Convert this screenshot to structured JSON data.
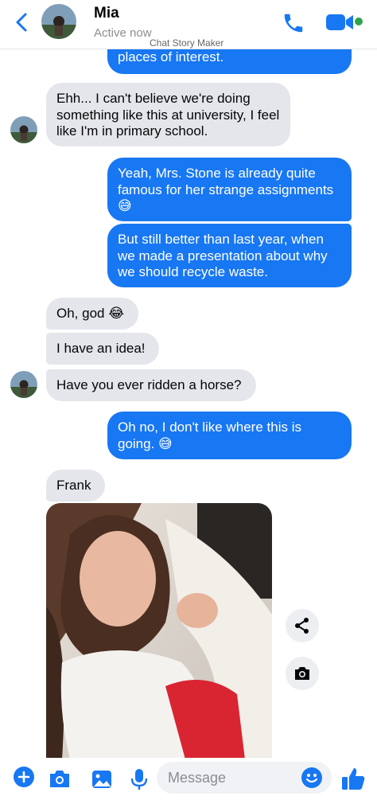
{
  "header": {
    "name": "Mia",
    "status": "Active now",
    "watermark": "Chat Story Maker"
  },
  "messages": [
    {
      "side": "out",
      "text": "places of interest."
    },
    {
      "side": "in",
      "text": "Ehh... I can't believe we're doing something like this at university, I feel like I'm in primary school."
    },
    {
      "side": "out",
      "text": "Yeah, Mrs. Stone is already quite famous for her strange assignments 😅"
    },
    {
      "side": "out",
      "text": "But still better than last year, when we made a presentation about why we should recycle waste."
    },
    {
      "side": "in",
      "text": "Oh, god 😂"
    },
    {
      "side": "in",
      "text": "I have an idea!"
    },
    {
      "side": "in",
      "text": "Have you ever ridden a horse?"
    },
    {
      "side": "out",
      "text": "Oh no, I don't like where this is going. 😅"
    },
    {
      "side": "in",
      "text": "Frank"
    }
  ],
  "composer": {
    "placeholder": "Message"
  },
  "icons": {
    "back": "chevron-left-icon",
    "call": "phone-icon",
    "video": "video-camera-icon",
    "share": "share-icon",
    "save": "camera-icon",
    "plus": "plus-circle-icon",
    "camera": "camera-icon",
    "gallery": "image-icon",
    "mic": "microphone-icon",
    "emoji": "smiley-icon",
    "like": "thumbs-up-icon"
  },
  "colors": {
    "accent": "#1877f2",
    "incoming_bubble": "#e4e6eb",
    "online": "#31a24c"
  }
}
